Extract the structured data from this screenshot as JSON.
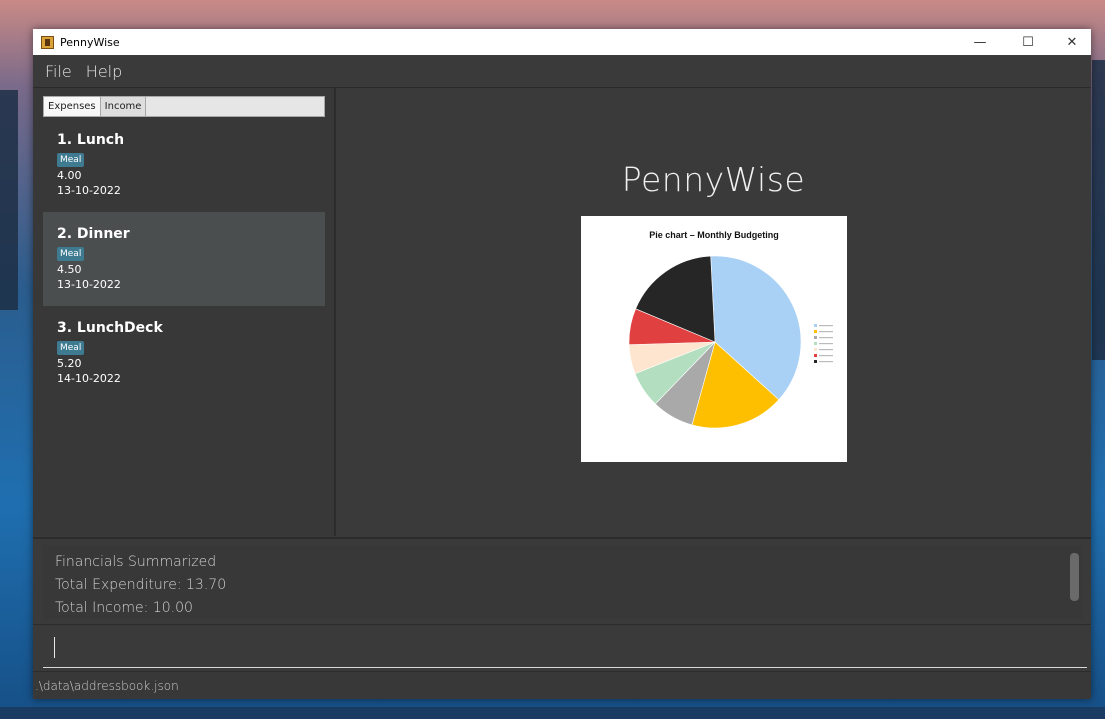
{
  "window": {
    "title": "PennyWise",
    "controls": {
      "minimize": "—",
      "maximize": "☐",
      "close": "✕"
    }
  },
  "menu": [
    "File",
    "Help"
  ],
  "tabs": [
    "Expenses",
    "Income"
  ],
  "entries": [
    {
      "title": "1.  Lunch",
      "tag": "Meal",
      "amount": "4.00",
      "date": "13-10-2022"
    },
    {
      "title": "2.  Dinner",
      "tag": "Meal",
      "amount": "4.50",
      "date": "13-10-2022"
    },
    {
      "title": "3.  LunchDeck",
      "tag": "Meal",
      "amount": "5.20",
      "date": "14-10-2022"
    }
  ],
  "main": {
    "heading": "PennyWise"
  },
  "chart_data": {
    "type": "pie",
    "title": "Pie chart – Monthly Budgeting",
    "slices": [
      {
        "value": 37.5,
        "color": "#a9d0f5"
      },
      {
        "value": 17.6,
        "color": "#fdbf00"
      },
      {
        "value": 7.9,
        "color": "#a9a9a9"
      },
      {
        "value": 6.8,
        "color": "#b3dfc0"
      },
      {
        "value": 5.5,
        "color": "#fde5cf"
      },
      {
        "value": 6.8,
        "color": "#e04040"
      },
      {
        "value": 17.9,
        "color": "#262626"
      }
    ],
    "legend_position": "right"
  },
  "result": {
    "lines": [
      "Financials Summarized",
      "Total Expenditure: 13.70",
      "Total Income: 10.00"
    ]
  },
  "command": {
    "value": ""
  },
  "status": {
    "path": ".\\data\\addressbook.json"
  }
}
